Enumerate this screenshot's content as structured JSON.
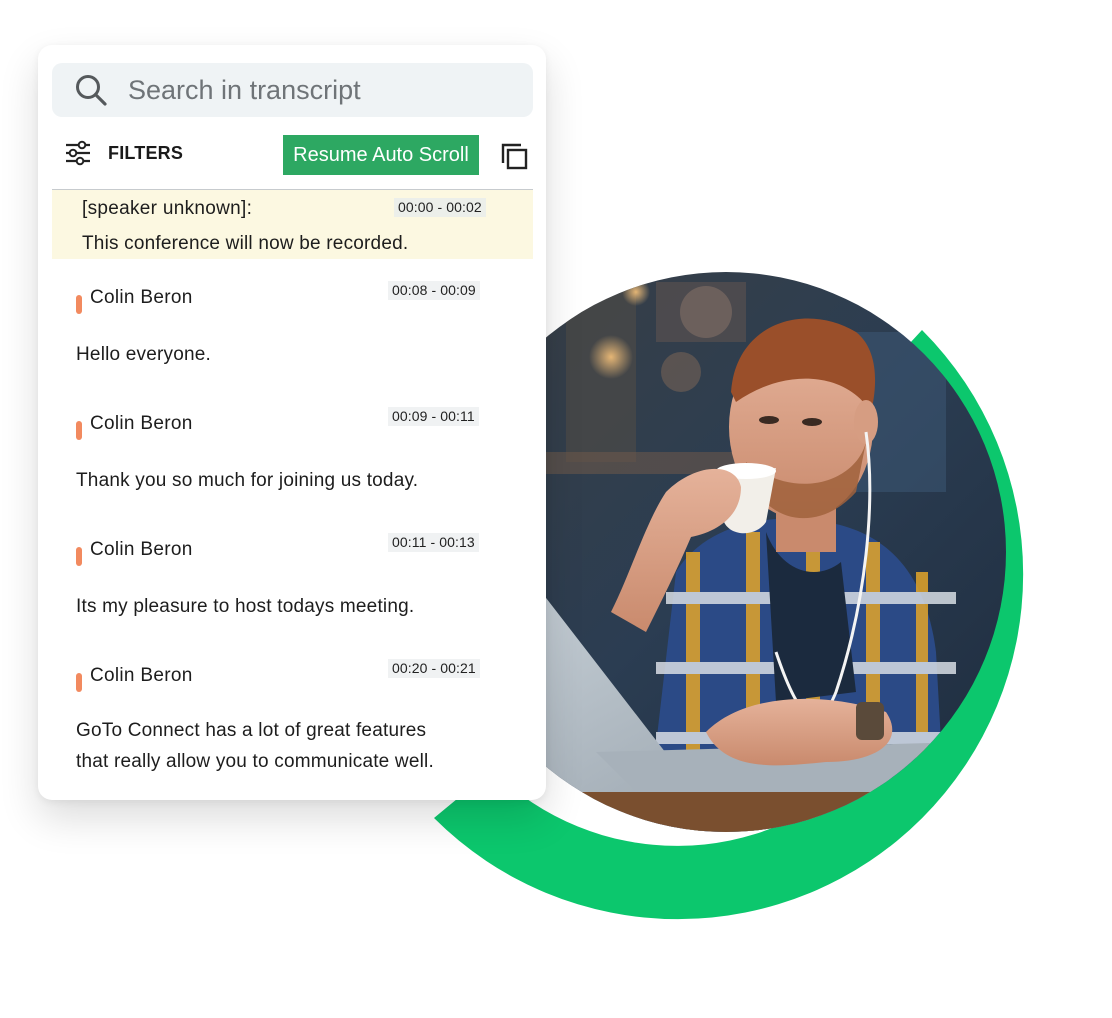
{
  "search": {
    "placeholder": "Search in transcript",
    "icon": "search-icon"
  },
  "toolbar": {
    "filters_label": "FILTERS",
    "filters_icon": "sliders-icon",
    "resume_label": "Resume Auto Scroll",
    "copy_icon": "copy-icon"
  },
  "colors": {
    "accent_green": "#2da862",
    "ring_green": "#0cc76d",
    "speaker_marker": "#f28a5f",
    "highlight_bg": "#fcf8e1"
  },
  "transcript": [
    {
      "speaker": "[speaker unknown]:",
      "time": "00:00 - 00:02",
      "lines": [
        "This conference will now be recorded."
      ]
    },
    {
      "speaker": "Colin Beron",
      "time": "00:08 - 00:09",
      "lines": [
        "Hello everyone."
      ]
    },
    {
      "speaker": "Colin Beron",
      "time": "00:09 - 00:11",
      "lines": [
        "Thank you so much for joining us today."
      ]
    },
    {
      "speaker": "Colin Beron",
      "time": "00:11 - 00:13",
      "lines": [
        "Its my pleasure to host todays meeting."
      ]
    },
    {
      "speaker": "Colin Beron",
      "time": "00:20 - 00:21",
      "lines": [
        "GoTo Connect has a lot of great features",
        "that really allow you to communicate well."
      ]
    }
  ]
}
